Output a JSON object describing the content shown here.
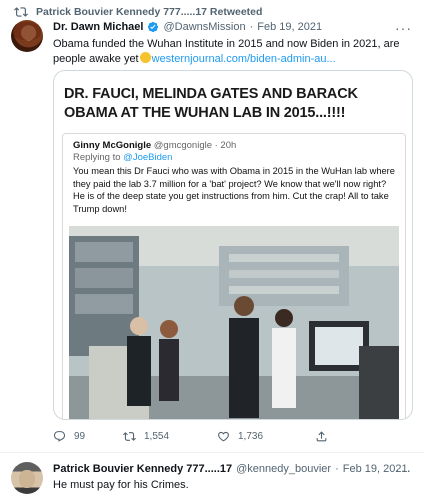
{
  "retweet_banner": {
    "text": "Patrick Bouvier Kennedy 777.....17 Retweeted"
  },
  "tweet1": {
    "author_name": "Dr. Dawn Michael",
    "handle": "@DawnsMission",
    "separator": "·",
    "date": "Feb 19, 2021",
    "text_line1": "Obama funded the Wuhan Institute in 2015 and now Biden in 2021, are",
    "text_line2_prefix": "people awake yet",
    "emoji": "thinking-face",
    "link": "westernjournal.com/biden-admin-au...",
    "meme": {
      "title": "DR. FAUCI, MELINDA GATES AND BARACK OBAMA AT THE WUHAN LAB IN 2015...!!!!",
      "quoted_name": "Ginny McGonigle",
      "quoted_handle": "@gmcgonigle · 20h",
      "replying_prefix": "Replying to",
      "replying_to": "@JoeBiden",
      "quoted_text": "You mean this Dr Fauci who was with Obama in 2015 in the WuHan lab where they paid the lab 3.7 million for a 'bat' project? We know that we'll now right? He is of the deep state you get instructions from him. Cut the crap! All to take Trump down!"
    },
    "stats": {
      "replies": "99",
      "retweets": "1,554",
      "likes": "1,736"
    }
  },
  "tweet2": {
    "author_name": "Patrick Bouvier Kennedy 777.....17",
    "handle": "@kennedy_bouvier",
    "separator": "·",
    "date": "Feb 19, 2021",
    "text": "He must pay for his Crimes."
  },
  "colors": {
    "accent": "#1d9bf0",
    "secondary_text": "#536471",
    "verified": "#1d9bf0"
  }
}
